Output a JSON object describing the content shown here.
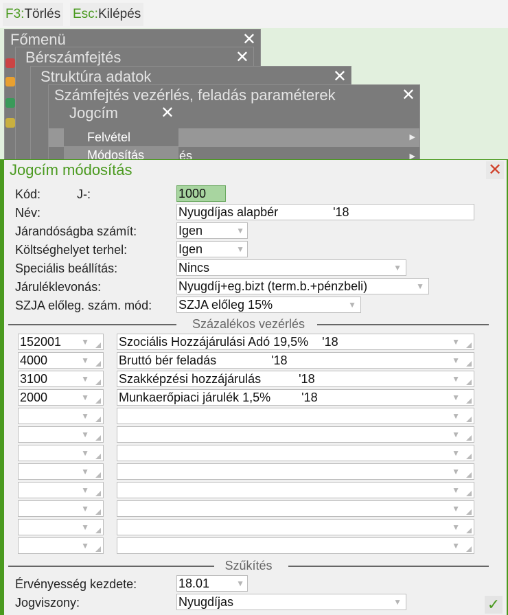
{
  "toolbar": {
    "f3_key": "F3:",
    "f3_label": "Törlés",
    "esc_key": "Esc:",
    "esc_label": "Kilépés"
  },
  "menus": {
    "fomenu": "Főmenü",
    "berszamfejtes": "Bérszámfejtés",
    "struktura": "Struktúra adatok",
    "szamfejtes": "Számfejtés vezérlés, feladás paraméterek",
    "szamfejtes_row2_partial": "és",
    "jogcim": "Jogcím",
    "jogcim_items": [
      "Felvétel",
      "Módosítás"
    ],
    "close": "✕"
  },
  "dialog": {
    "title": "Jogcím módosítás",
    "close": "✕",
    "ok": "✓",
    "fields": {
      "kod_label": "Kód:",
      "kod_prefix": "J-:",
      "kod_value": "1000",
      "nev_label": "Név:",
      "nev_value": "Nyugdíjas alapbér                '18",
      "jarandosag_label": "Járandóságba számít:",
      "jarandosag_value": "Igen",
      "koltseghely_label": "Költséghelyet terhel:",
      "koltseghely_value": "Igen",
      "specialis_label": "Speciális beállítás:",
      "specialis_value": "Nincs",
      "jarulek_label": "Járuléklevonás:",
      "jarulek_value": "Nyugdíj+eg.bizt (term.b.+pénzbeli)",
      "szja_label": "SZJA előleg. szám. mód:",
      "szja_value": "SZJA előleg 15%"
    },
    "szazalekos_title": "Százalékos vezérlés",
    "szazalekos_rows": [
      {
        "code": "152001",
        "name": "Szociális Hozzájárulási Adó 19,5%    '18"
      },
      {
        "code": "4000",
        "name": "Bruttó bér feladás                '18"
      },
      {
        "code": "3100",
        "name": "Szakképzési hozzájárulás           '18"
      },
      {
        "code": "2000",
        "name": "Munkaerőpiaci járulék 1,5%         '18"
      },
      {
        "code": "",
        "name": ""
      },
      {
        "code": "",
        "name": ""
      },
      {
        "code": "",
        "name": ""
      },
      {
        "code": "",
        "name": ""
      },
      {
        "code": "",
        "name": ""
      },
      {
        "code": "",
        "name": ""
      },
      {
        "code": "",
        "name": ""
      },
      {
        "code": "",
        "name": ""
      }
    ],
    "szukites_title": "Szűkítés",
    "ervenyesseg_label": "Érvényesség kezdete:",
    "ervenyesseg_value": "18.01",
    "jogviszony_label": "Jogviszony:",
    "jogviszony_value": "Nyugdíjas"
  }
}
